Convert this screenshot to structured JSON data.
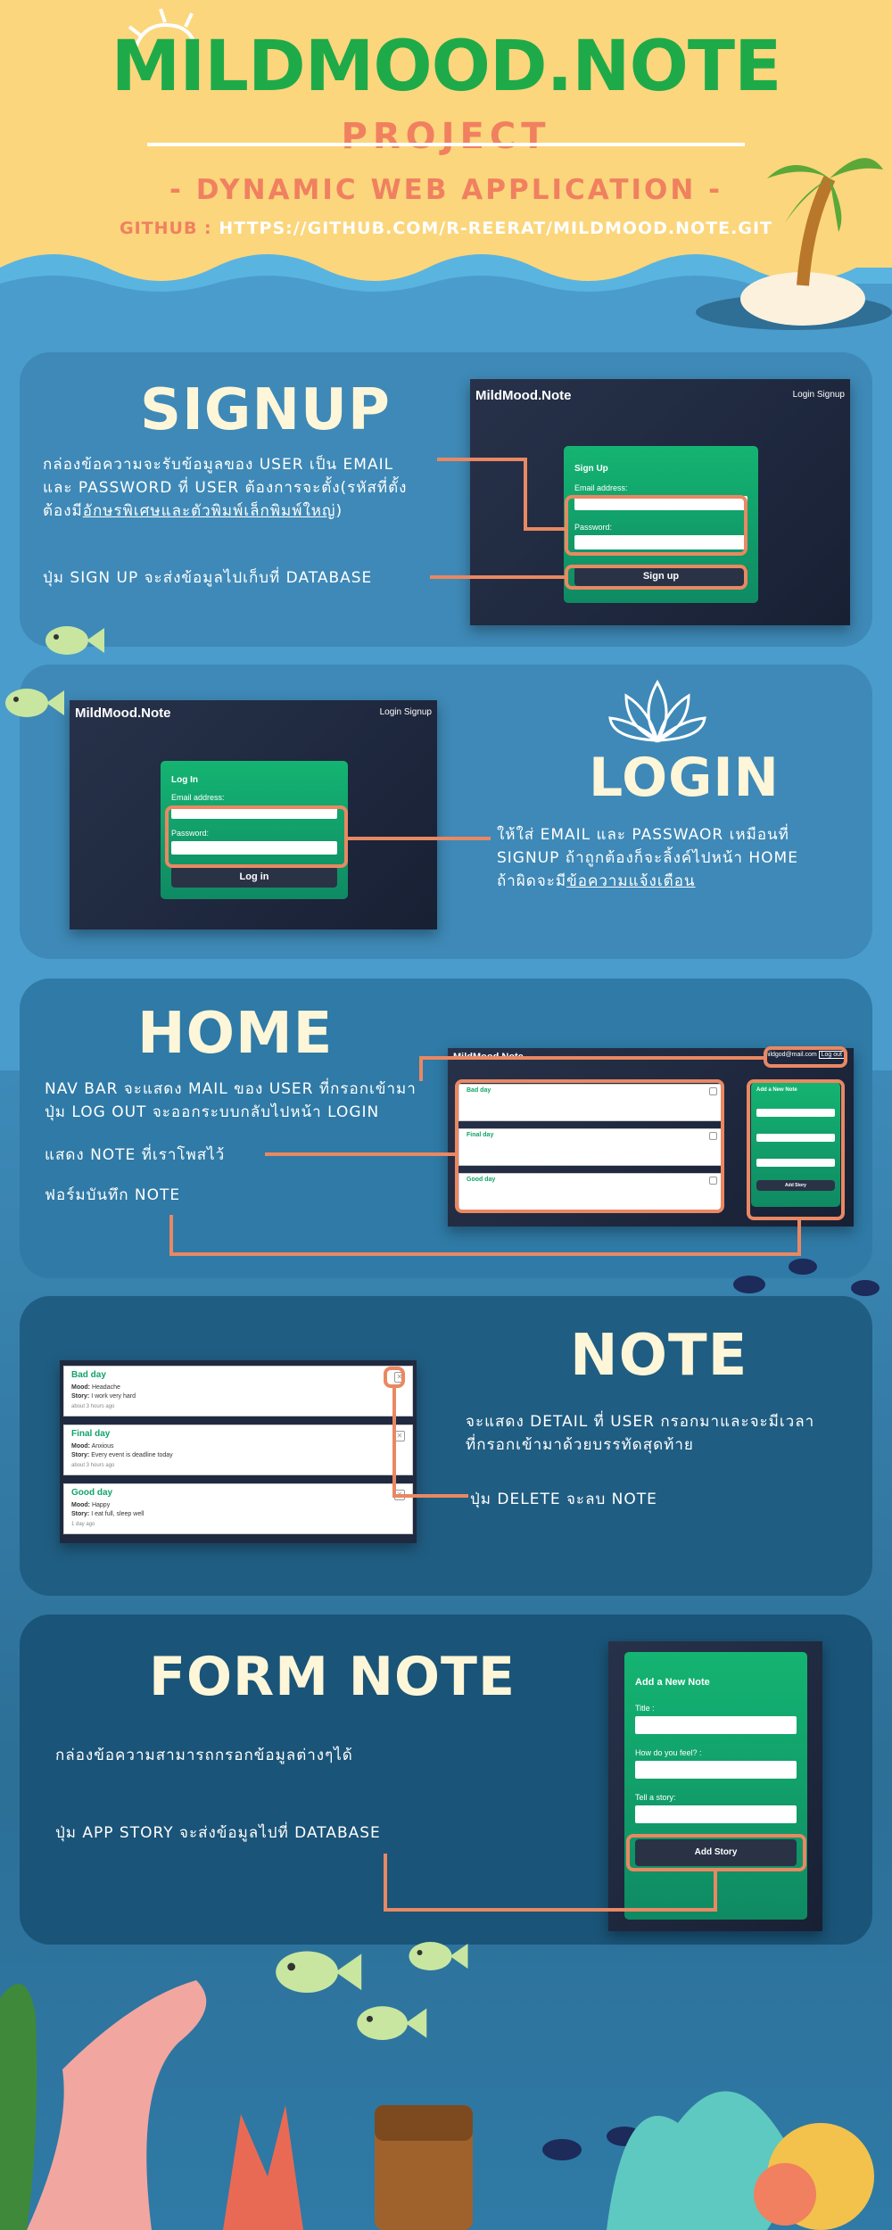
{
  "header": {
    "title": "MILDMOOD.NOTE",
    "subtitle": "PROJECT",
    "tagline": "- DYNAMIC WEB APPLICATION -",
    "github_label": "GITHUB :",
    "github_url": "HTTPS://GITHUB.COM/R-REERAT/MILDMOOD.NOTE.GIT"
  },
  "app": {
    "brand": "MildMood.Note",
    "nav_login": "Login",
    "nav_signup": "Signup",
    "nav_email": "mildgod@mail.com",
    "nav_logout": "Log out",
    "email_label": "Email address:",
    "password_label": "Password:"
  },
  "signup": {
    "title": "SIGNUP",
    "desc_line1": "กล่องข้อความจะรับข้อมูลของ USER เป็น EMAIL",
    "desc_line2": "และ PASSWORD ที่ USER ต้องการจะตั้ง(รหัสที่ตั้ง",
    "desc_line3_pre": "ต้องมี",
    "desc_line3_u": "อักษรพิเศษและตัวพิมพ์เล็กพิมพ์ใหญ่",
    "desc_line3_post": ")",
    "button_desc": "ปุ่ม SIGN UP จะส่งข้อมูลไปเก็บที่ DATABASE",
    "card_title": "Sign Up",
    "button_label": "Sign up"
  },
  "login": {
    "title": "LOGIN",
    "desc_line1": "ให้ใส่ EMAIL และ PASSWAOR เหมือนที่",
    "desc_line2": "SIGNUP ถ้าถูกต้องก็จะลิ้งค์ไปหน้า HOME",
    "desc_line3_pre": "ถ้าผิดจะมี",
    "desc_line3_u": "ข้อความแจ้งเตือน",
    "card_title": "Log In",
    "button_label": "Log in"
  },
  "home": {
    "title": "HOME",
    "desc_line1": "NAV BAR จะแสดง MAIL ของ USER ที่กรอกเข้ามา",
    "desc_line2": "ปุ่ม LOG OUT จะออกระบบกลับไปหน้า LOGIN",
    "desc_notes": "แสดง NOTE ที่เราโพสไว้",
    "desc_form": "ฟอร์มบันทึก NOTE"
  },
  "note": {
    "title": "NOTE",
    "desc_line1": "จะแสดง DETAIL ที่ USER กรอกมาและจะมีเวลา",
    "desc_line2": "ที่กรอกเข้ามาด้วยบรรทัดสุดท้าย",
    "delete_desc": "ปุ่ม DELETE จะลบ NOTE",
    "mood_label": "Mood:",
    "story_label": "Story:",
    "items": [
      {
        "title": "Bad day",
        "mood": "Headache",
        "story": "I work very hard",
        "time": "about 3 hours ago"
      },
      {
        "title": "Final day",
        "mood": "Anxious",
        "story": "Every event is deadline today",
        "time": "about 3 hours ago"
      },
      {
        "title": "Good day",
        "mood": "Happy",
        "story": "I eat full, sleep well",
        "time": "1 day ago"
      }
    ]
  },
  "form": {
    "title": "FORM NOTE",
    "desc_inputs": "กล่องข้อความสามารถกรอกข้อมูลต่างๆได้",
    "desc_button": "ปุ่ม APP STORY จะส่งข้อมูลไปที่ DATABASE",
    "card_title": "Add a New Note",
    "title_label": "Title :",
    "feel_label": "How do you feel? :",
    "story_label": "Tell a story:",
    "button_label": "Add Story"
  },
  "colors": {
    "header_bg": "#fbd67c",
    "title_green": "#1faa4a",
    "accent_orange": "#f08060",
    "highlight": "#e98862",
    "card_green": "#14b472",
    "title_cream": "#fdf6d8"
  }
}
